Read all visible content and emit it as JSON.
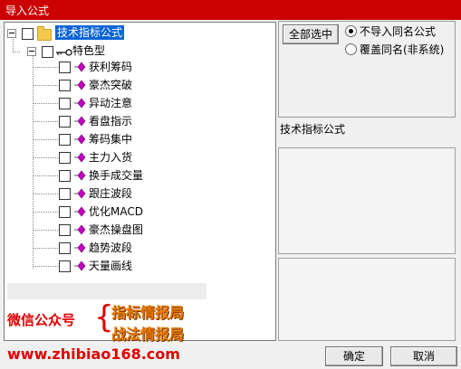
{
  "window": {
    "title": "导入公式"
  },
  "tree": {
    "root": {
      "label": "技术指标公式",
      "checked": false,
      "expanded": true
    },
    "group": {
      "label": "特色型",
      "checked": false,
      "expanded": true
    },
    "items": [
      {
        "label": "获利筹码",
        "checked": false
      },
      {
        "label": "豪杰突破",
        "checked": false
      },
      {
        "label": "异动注意",
        "checked": false
      },
      {
        "label": "看盘指示",
        "checked": false
      },
      {
        "label": "筹码集中",
        "checked": false
      },
      {
        "label": "主力入货",
        "checked": false
      },
      {
        "label": "换手成交量",
        "checked": false
      },
      {
        "label": "跟庄波段",
        "checked": false
      },
      {
        "label": "优化MACD",
        "checked": false
      },
      {
        "label": "豪杰操盘图",
        "checked": false
      },
      {
        "label": "趋势波段",
        "checked": false
      },
      {
        "label": "天量画线",
        "checked": false
      }
    ]
  },
  "right": {
    "select_all_label": "全部选中",
    "options": [
      {
        "label": "不导入同名公式",
        "selected": true
      },
      {
        "label": "覆盖同名(非系统)",
        "selected": false
      }
    ],
    "formula_type_label": "技术指标公式"
  },
  "watermark": {
    "left_text": "微信公众号",
    "brace": "{",
    "line1": "指标情报局",
    "line2": "战法情报局",
    "url": "www.zhibiao168.com"
  },
  "footer": {
    "ok_label": "确定",
    "cancel_label": "取消"
  },
  "colors": {
    "title_bg": "#cc0000",
    "selection": "#0a64d8",
    "watermark_red": "#e00000",
    "watermark_orange": "#e87a00"
  }
}
